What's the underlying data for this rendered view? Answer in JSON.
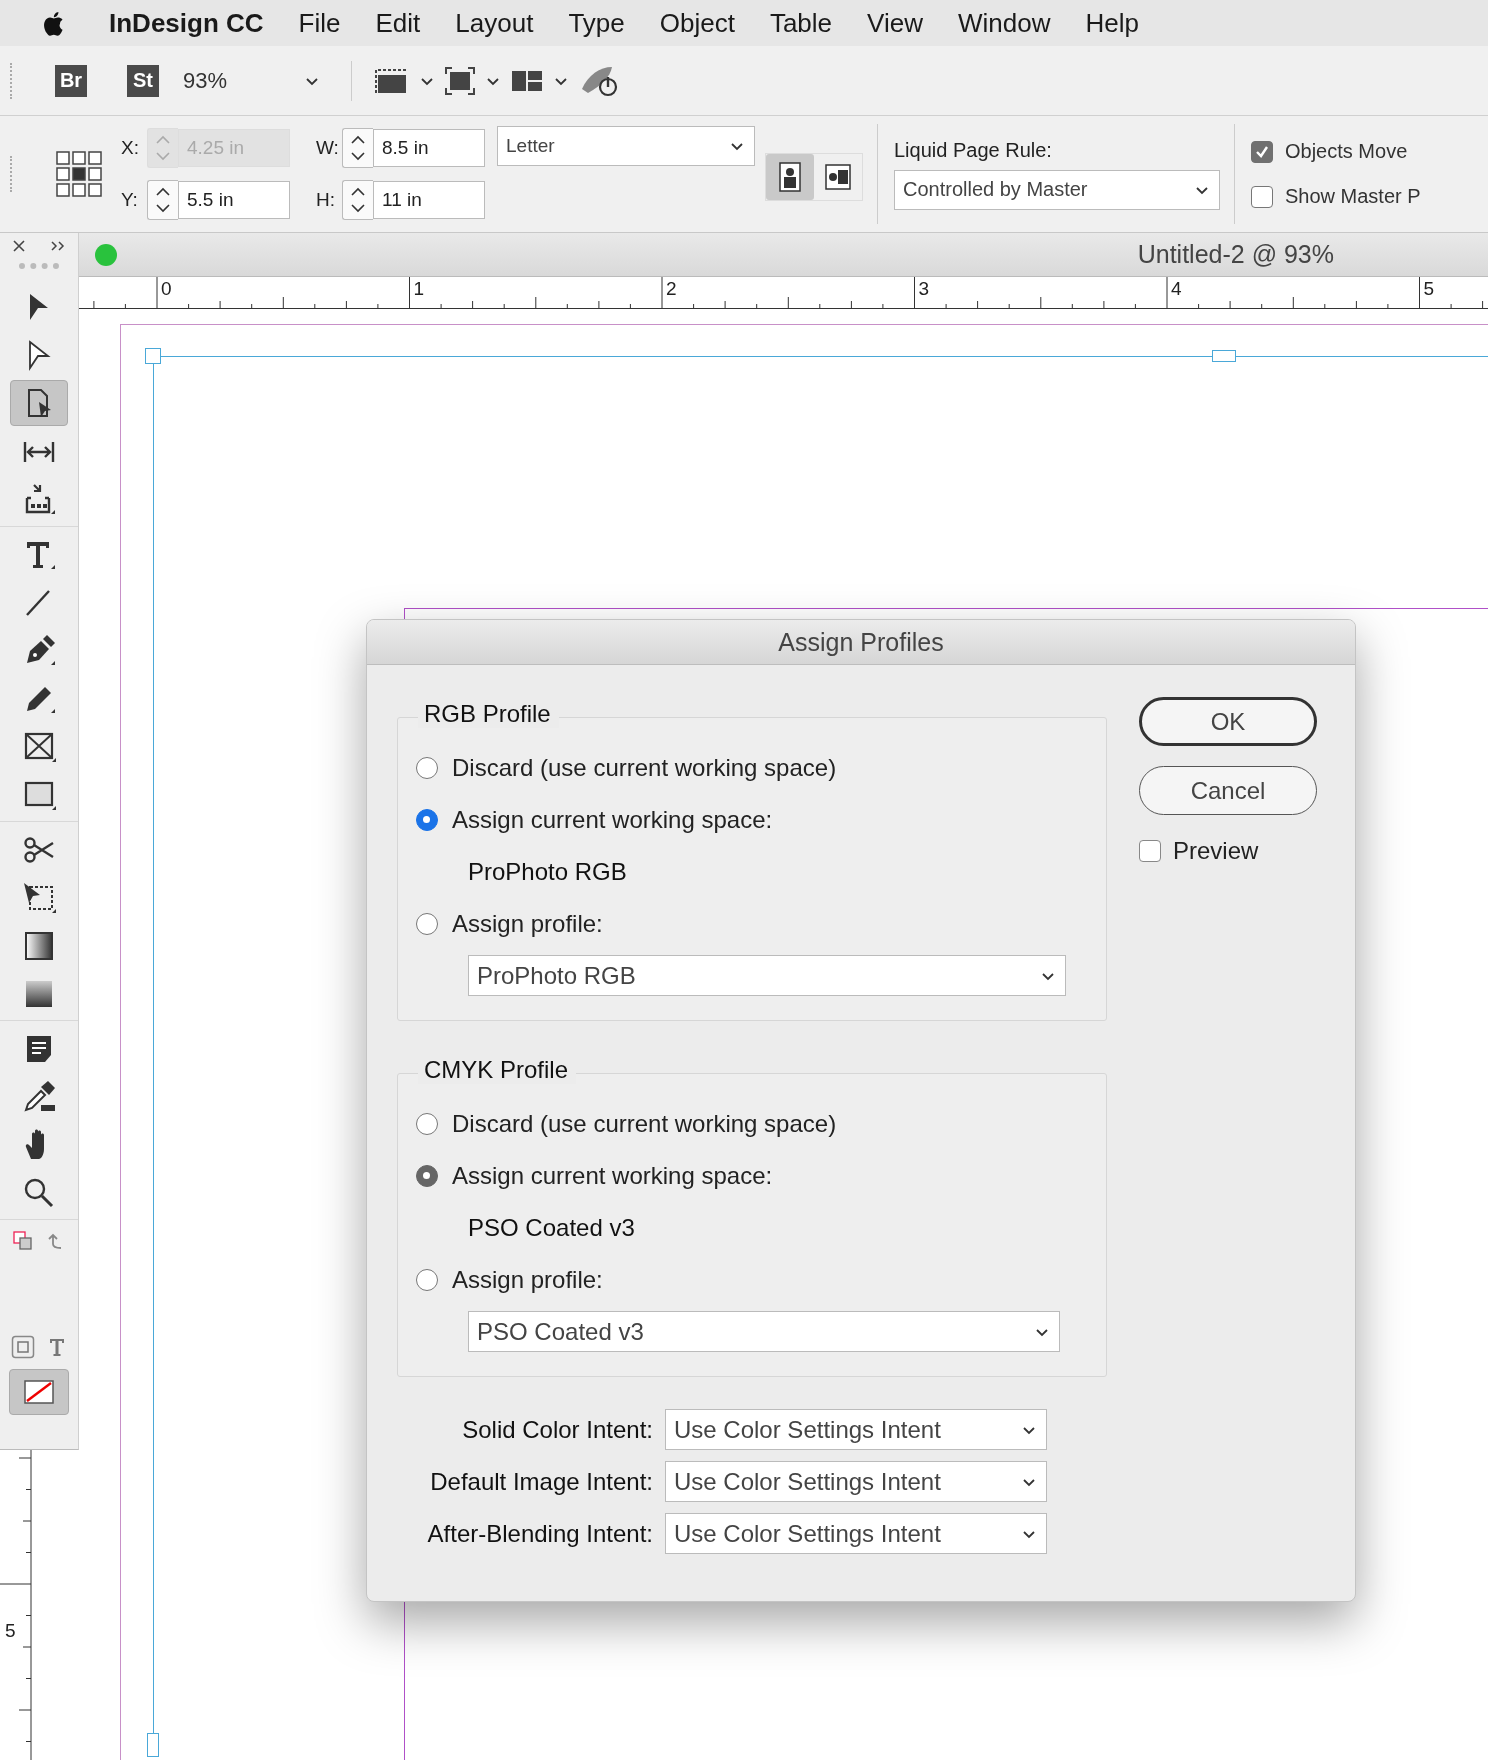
{
  "menu_bar": {
    "app": "InDesign CC",
    "items": [
      "File",
      "Edit",
      "Layout",
      "Type",
      "Object",
      "Table",
      "View",
      "Window",
      "Help"
    ]
  },
  "control_bar": {
    "bridge": "Br",
    "stock": "St",
    "zoom": "93%"
  },
  "transform": {
    "fields": [
      {
        "label": "X:",
        "value": "4.25 in",
        "disabled": true
      },
      {
        "label": "Y:",
        "value": "5.5 in",
        "disabled": false
      },
      {
        "label": "W:",
        "value": "8.5 in",
        "disabled": false
      },
      {
        "label": "H:",
        "value": "11 in",
        "disabled": false
      }
    ],
    "page_size": "Letter",
    "orientation": [
      {
        "kind": "portrait",
        "selected": true
      },
      {
        "kind": "landscape",
        "selected": false
      }
    ],
    "liquid_page_rule": {
      "label": "Liquid Page Rule:",
      "value": "Controlled by Master"
    },
    "options": [
      {
        "label": "Objects Move",
        "checked": true
      },
      {
        "label": "Show Master P",
        "checked": false
      }
    ]
  },
  "tools_panel": {
    "groups": [
      [
        {
          "kind": "selection",
          "selected": false
        },
        {
          "kind": "direct-selection",
          "selected": false
        },
        {
          "kind": "page",
          "selected": true
        },
        {
          "kind": "gap",
          "selected": false
        },
        {
          "kind": "content-collector",
          "selected": false
        }
      ],
      [
        {
          "kind": "type",
          "selected": false
        },
        {
          "kind": "line",
          "selected": false
        },
        {
          "kind": "pen",
          "selected": false
        },
        {
          "kind": "pencil",
          "selected": false
        },
        {
          "kind": "rectangle-frame",
          "selected": false
        },
        {
          "kind": "rectangle",
          "selected": false
        }
      ],
      [
        {
          "kind": "scissors",
          "selected": false
        },
        {
          "kind": "free-transform",
          "selected": false
        },
        {
          "kind": "gradient",
          "selected": false
        },
        {
          "kind": "gradient-feather",
          "selected": false
        }
      ],
      [
        {
          "kind": "note",
          "selected": false
        },
        {
          "kind": "eyedropper",
          "selected": false
        },
        {
          "kind": "hand",
          "selected": false
        },
        {
          "kind": "zoom",
          "selected": false
        }
      ]
    ]
  },
  "document": {
    "title": "Untitled-2 @ 93%",
    "ruler": [
      "0",
      "1",
      "2",
      "3",
      "4",
      "5"
    ],
    "vertical_ruler": [
      "5"
    ]
  },
  "dialog": {
    "title": "Assign Profiles",
    "groups": [
      {
        "title": "RGB Profile",
        "color": "#1a73e8",
        "options": [
          {
            "label": "Discard (use current working space)",
            "selected": false
          },
          {
            "label": "Assign current working space:",
            "selected": true
          },
          {
            "label": "Assign profile:",
            "selected": false
          }
        ],
        "working_space": "ProPhoto RGB",
        "profile": "ProPhoto RGB"
      },
      {
        "title": "CMYK Profile",
        "color": "#666666",
        "options": [
          {
            "label": "Discard (use current working space)",
            "selected": false
          },
          {
            "label": "Assign current working space:",
            "selected": true
          },
          {
            "label": "Assign profile:",
            "selected": false
          }
        ],
        "working_space": "PSO Coated v3",
        "profile": "PSO Coated v3"
      }
    ],
    "intents": [
      {
        "label": "Solid Color Intent:",
        "value": "Use Color Settings Intent"
      },
      {
        "label": "Default Image Intent:",
        "value": "Use Color Settings Intent"
      },
      {
        "label": "After-Blending Intent:",
        "value": "Use Color Settings Intent"
      }
    ],
    "buttons": [
      {
        "label": "OK",
        "default": true
      },
      {
        "label": "Cancel",
        "default": false
      }
    ],
    "preview": {
      "label": "Preview",
      "checked": false
    }
  }
}
